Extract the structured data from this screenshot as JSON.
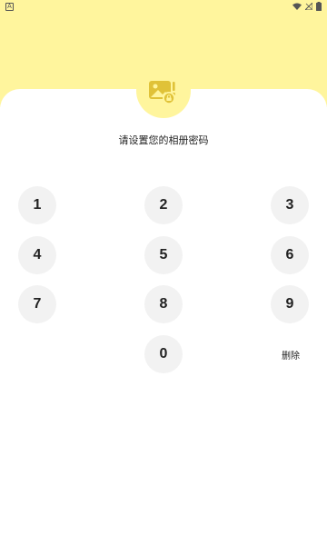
{
  "status_bar": {
    "left_icon": "A",
    "right_icons": [
      "wifi-icon",
      "signal-icon",
      "battery-icon"
    ]
  },
  "header": {
    "bg_color": "#fff59d",
    "logo_icon": "album-lock-icon"
  },
  "title": "请设置您的相册密码",
  "keypad": {
    "keys": [
      "1",
      "2",
      "3",
      "4",
      "5",
      "6",
      "7",
      "8",
      "9",
      "0"
    ],
    "delete_label": "删除",
    "key_bg_color": "#f2f2f2"
  }
}
